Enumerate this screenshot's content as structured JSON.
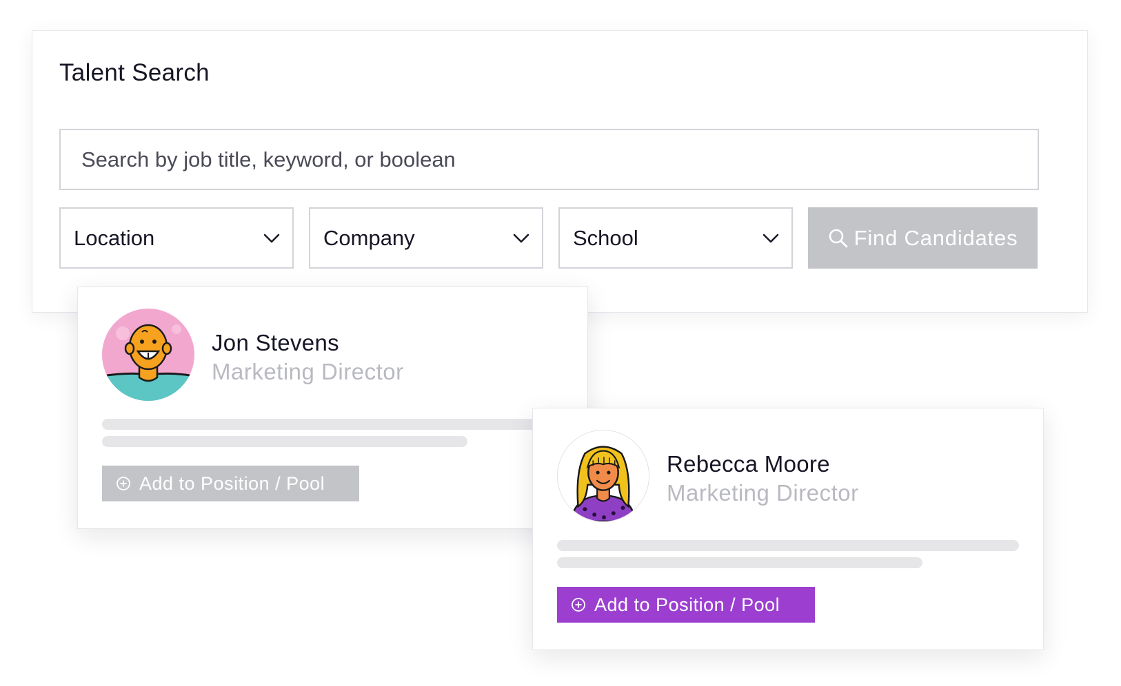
{
  "search_panel": {
    "title": "Talent Search",
    "search_placeholder": "Search by job title, keyword, or boolean",
    "filters": [
      {
        "label": "Location",
        "icon": "chevron-down-icon"
      },
      {
        "label": "Company",
        "icon": "chevron-down-icon"
      },
      {
        "label": "School",
        "icon": "chevron-down-icon"
      }
    ],
    "find_button": {
      "label": "Find Candidates",
      "icon": "search-icon",
      "color": "#c3c4c8"
    }
  },
  "candidates": [
    {
      "name": "Jon Stevens",
      "title": "Marketing Director",
      "avatar_icon": "illustrated-man-avatar",
      "add_button": {
        "label": "Add to Position / Pool",
        "icon": "plus-circle-icon",
        "color": "#c3c4c8",
        "state": "disabled"
      }
    },
    {
      "name": "Rebecca Moore",
      "title": "Marketing Director",
      "avatar_icon": "illustrated-woman-avatar",
      "add_button": {
        "label": "Add to Position / Pool",
        "icon": "plus-circle-icon",
        "color": "#9c3fd0",
        "state": "active"
      }
    }
  ]
}
